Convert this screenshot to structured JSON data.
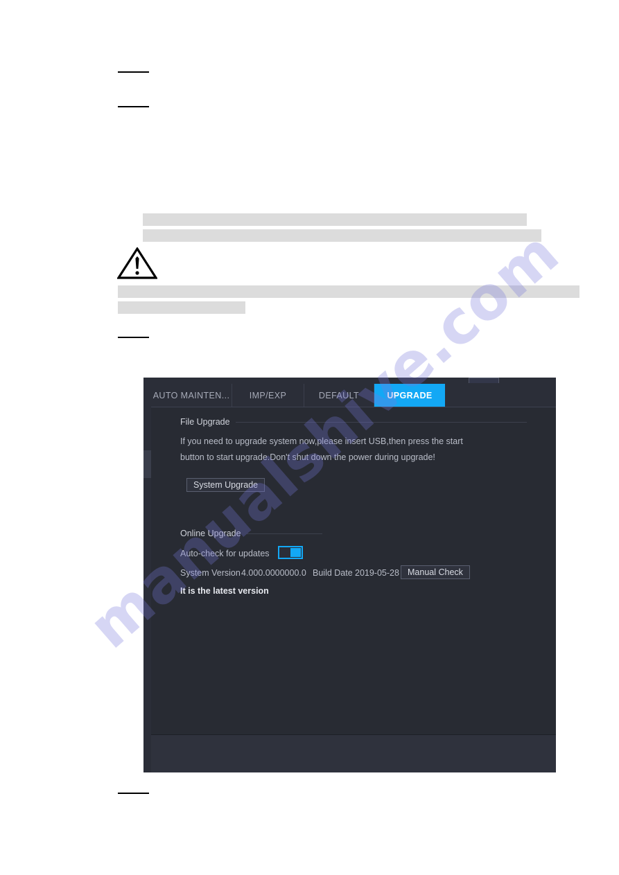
{
  "document": {
    "watermark": "manualshive.com",
    "redaction_note": "redacted",
    "warning_icon": "warning-triangle-icon"
  },
  "device": {
    "tabs": [
      {
        "label": "AUTO MAINTEN...",
        "active": false
      },
      {
        "label": "IMP/EXP",
        "active": false
      },
      {
        "label": "DEFAULT",
        "active": false
      },
      {
        "label": "UPGRADE",
        "active": true
      }
    ],
    "sections": {
      "file_upgrade": {
        "title": "File Upgrade",
        "description_line1": "If you need to upgrade system now,please insert USB,then press the start",
        "description_line2": "button to start upgrade.Don't shut down the power during upgrade!",
        "system_upgrade_button": "System Upgrade"
      },
      "online_upgrade": {
        "title": "Online Upgrade",
        "auto_check_label": "Auto-check for updates",
        "auto_check_state": "on",
        "system_version_label": "System Version",
        "system_version_value": "4.000.0000000.0",
        "build_date_label": "Build Date",
        "build_date_value": "2019-05-28",
        "manual_check_button": "Manual Check",
        "status": "It is the latest version"
      }
    },
    "colors": {
      "accent": "#13a8f5",
      "panel_bg": "#282b33",
      "chrome_bg": "#2b2e38",
      "footer_bg": "#2f323d",
      "text": "#b9bdc8"
    }
  }
}
